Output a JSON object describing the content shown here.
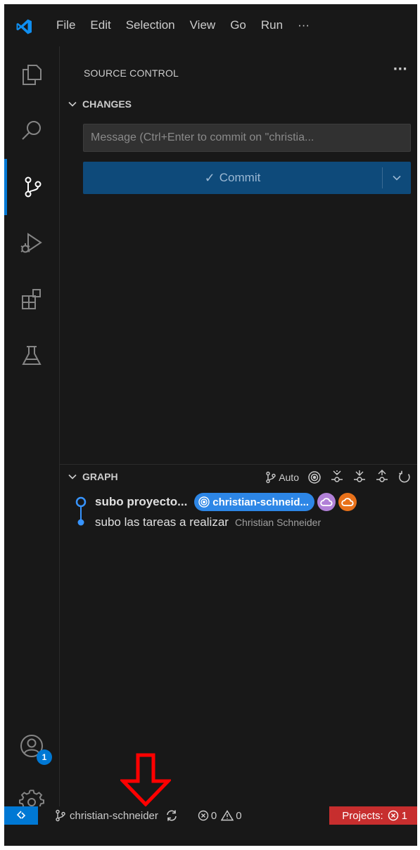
{
  "menu": [
    "File",
    "Edit",
    "Selection",
    "View",
    "Go",
    "Run",
    "···"
  ],
  "activity_bar": {
    "items": [
      "explorer-icon",
      "search-icon",
      "source-control-icon",
      "run-debug-icon",
      "extensions-icon",
      "testing-icon"
    ],
    "active": "source-control-icon",
    "accounts_badge": "1"
  },
  "sidebar": {
    "title": "SOURCE CONTROL",
    "more": "···",
    "changes": {
      "header": "CHANGES",
      "message_placeholder": "Message (Ctrl+Enter to commit on \"christia...",
      "commit_label": "Commit"
    },
    "graph": {
      "header": "GRAPH",
      "auto_label": "Auto",
      "commits": [
        {
          "message": "subo proyecto...",
          "branch": "christian-schneid...",
          "head": true
        },
        {
          "message": "subo las tareas a realizar",
          "author": "Christian Schneider",
          "head": false
        }
      ]
    }
  },
  "statusbar": {
    "branch": "christian-schneider",
    "errors": "0",
    "warnings": "0",
    "projects": "Projects:",
    "projects_count": "1"
  },
  "colors": {
    "accent": "#0078d4",
    "commit_button": "#0e4a7a",
    "branch_pill": "#2d86e6",
    "cloud_purple": "#b180d7",
    "cloud_orange": "#e8711a",
    "error_bar": "#c72e2e",
    "annotation_arrow": "#ff0000"
  }
}
